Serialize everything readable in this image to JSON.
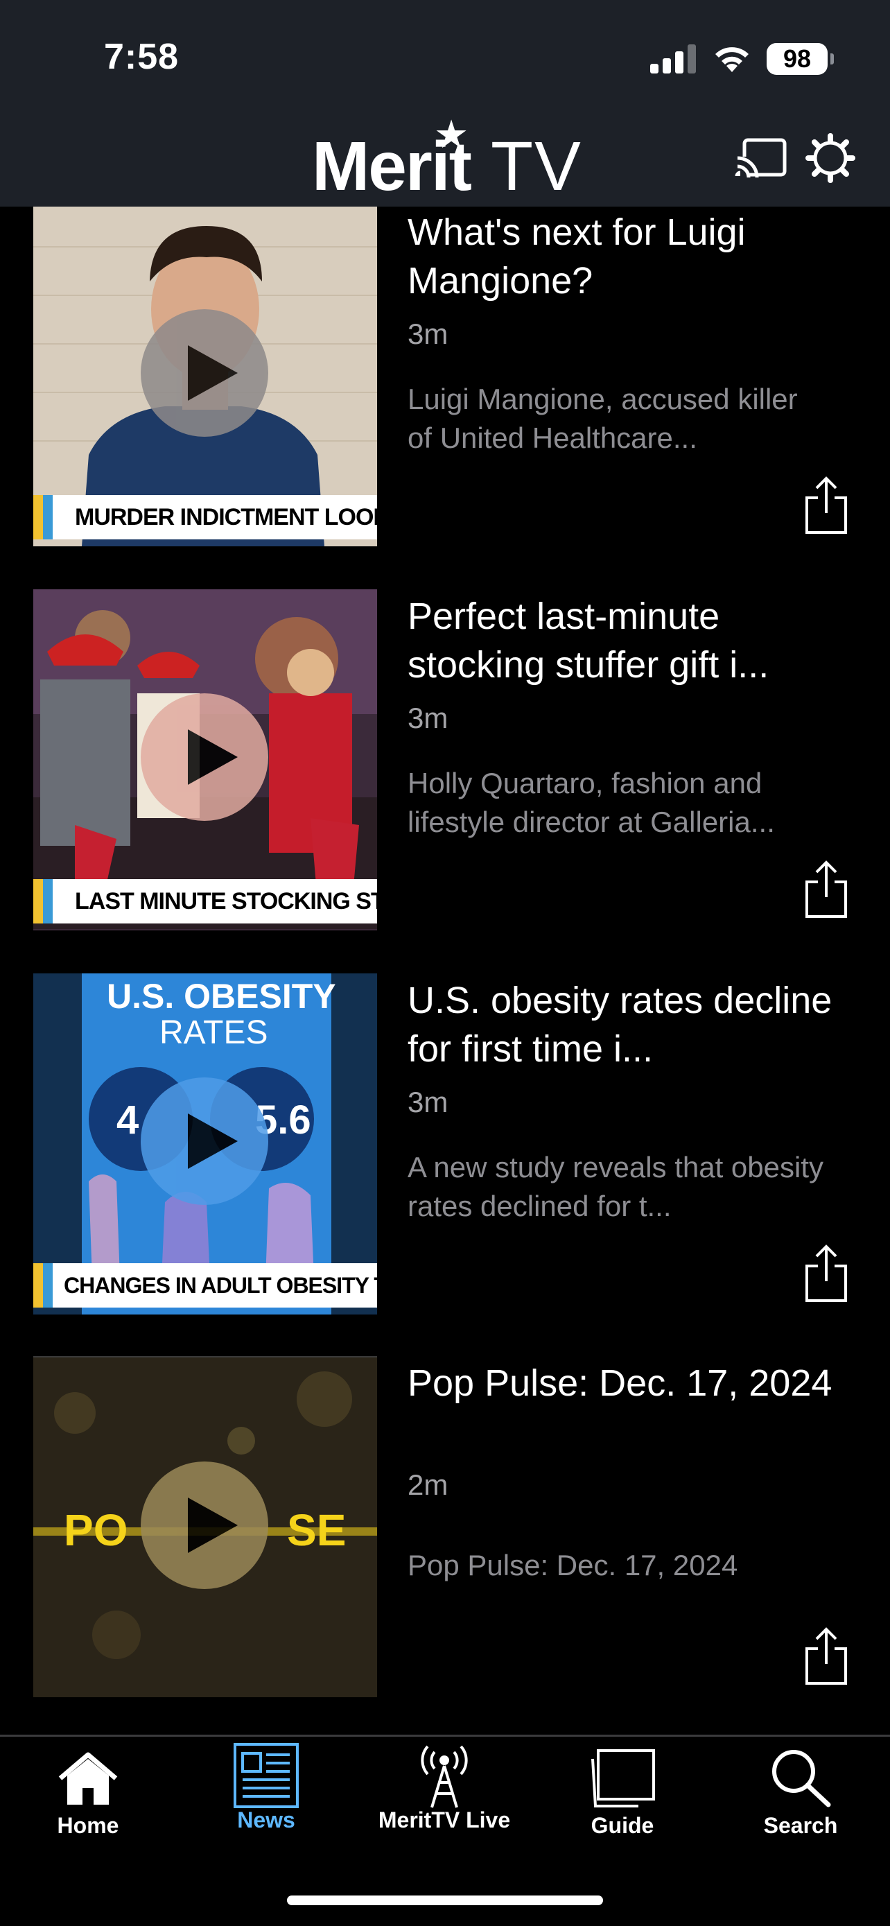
{
  "status": {
    "time": "7:58",
    "battery": "98"
  },
  "header": {
    "logo_merit": "Merit",
    "logo_tv": "TV"
  },
  "feed": [
    {
      "title": "What's next for Luigi Mangione?",
      "duration": "3m",
      "description": "Luigi Mangione, accused killer of United Healthcare...",
      "lower_third": "MURDER INDICTMENT LOOMS IN NE"
    },
    {
      "title": "Perfect last-minute stocking stuffer gift i...",
      "duration": "3m",
      "description": "Holly Quartaro, fashion and lifestyle director at Galleria...",
      "lower_third": "LAST MINUTE STOCKING STUFFER"
    },
    {
      "title": "U.S. obesity rates decline for first time i...",
      "duration": "3m",
      "description": "A new study reveals that obesity rates declined for t...",
      "lower_third": "CHANGES IN ADULT OBESITY TRENDS I",
      "thumb_heading_1": "U.S. OBESITY",
      "thumb_heading_2": "RATES",
      "thumb_stat_left": "4",
      "thumb_stat_right": "5.6"
    },
    {
      "title": "Pop Pulse: Dec. 17, 2024",
      "duration": "2m",
      "description": "Pop Pulse: Dec. 17, 2024",
      "thumb_text_left": "PO",
      "thumb_text_right": "SE"
    }
  ],
  "tabs": [
    {
      "label": "Home",
      "icon": "house-icon"
    },
    {
      "label": "News",
      "icon": "newspaper-icon"
    },
    {
      "label": "MeritTV Live",
      "icon": "broadcast-tower-icon"
    },
    {
      "label": "Guide",
      "icon": "guide-pages-icon"
    },
    {
      "label": "Search",
      "icon": "magnifier-icon"
    }
  ],
  "colors": {
    "header_bg": "#1d2128",
    "active_tab": "#5eb8ff",
    "lower_third_accent": "#f2c230"
  }
}
